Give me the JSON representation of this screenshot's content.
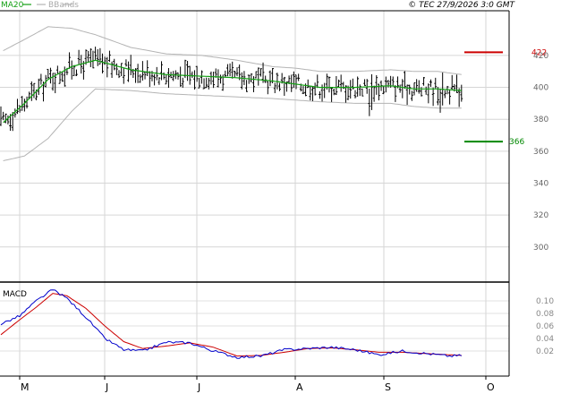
{
  "header": {
    "legend_ma_label": "MA20",
    "legend_bb_label": "BBands",
    "copyright": "© TEC 27/9/2026 3:0 GMT"
  },
  "colors": {
    "ohlc": "#000000",
    "ma20": "#14a014",
    "bbands": "#b4b4b4",
    "macd": "#0000cc",
    "signal": "#cc0000",
    "resistance": "#cc0000",
    "support": "#008800",
    "grid": "#d6d6d6",
    "axis": "#000000"
  },
  "chart_data": [
    {
      "type": "ohlc",
      "ylim": [
        278,
        448
      ],
      "yticks": [
        300,
        320,
        340,
        360,
        380,
        400,
        420
      ],
      "xlabels": [
        "M",
        "J",
        "J",
        "A",
        "S",
        "O"
      ],
      "series": [
        {
          "name": "MA20",
          "x": [
            1,
            10,
            20,
            30,
            40,
            55,
            70,
            85,
            100,
            115,
            125,
            135,
            150,
            165,
            175,
            185,
            195
          ],
          "values": [
            378,
            390,
            405,
            413,
            417,
            411,
            408,
            407,
            406,
            404,
            402,
            400,
            400,
            401,
            399,
            399,
            398
          ]
        },
        {
          "name": "BBands upper",
          "x": [
            1,
            10,
            20,
            30,
            40,
            55,
            70,
            85,
            100,
            115,
            125,
            135,
            150,
            165,
            175,
            185,
            195
          ],
          "values": [
            423,
            430,
            438,
            437,
            433,
            425,
            421,
            420,
            417,
            413,
            412,
            410,
            410,
            411,
            410,
            410,
            408
          ]
        },
        {
          "name": "BBands lower",
          "x": [
            1,
            10,
            20,
            30,
            40,
            55,
            70,
            85,
            100,
            115,
            125,
            135,
            150,
            165,
            175,
            185,
            195
          ],
          "values": [
            354,
            357,
            368,
            385,
            399,
            398,
            396,
            395,
            394,
            393,
            392,
            391,
            390,
            390,
            388,
            387,
            387
          ]
        }
      ],
      "levels": [
        {
          "name": "resistance",
          "value": 422,
          "label": "422"
        },
        {
          "name": "support",
          "value": 366,
          "label": "366"
        }
      ]
    },
    {
      "type": "line",
      "title": "MACD",
      "ylim": [
        -0.02,
        0.13
      ],
      "yticks": [
        0.02,
        0.04,
        0.06,
        0.08,
        0.1
      ],
      "ytick_labels": [
        "0.02",
        "0.04",
        "0.06",
        "0.08",
        "0.10"
      ],
      "series": [
        {
          "name": "MACD",
          "x": [
            0,
            8,
            15,
            22,
            28,
            36,
            44,
            52,
            60,
            70,
            80,
            90,
            100,
            110,
            120,
            130,
            140,
            150,
            160,
            170,
            180,
            190,
            195
          ],
          "values": [
            0.063,
            0.076,
            0.1,
            0.118,
            0.104,
            0.074,
            0.04,
            0.022,
            0.02,
            0.034,
            0.033,
            0.02,
            0.01,
            0.012,
            0.022,
            0.024,
            0.026,
            0.022,
            0.014,
            0.02,
            0.016,
            0.012,
            0.013
          ]
        },
        {
          "name": "Signal",
          "x": [
            0,
            8,
            15,
            22,
            28,
            36,
            44,
            52,
            60,
            70,
            80,
            90,
            100,
            110,
            120,
            130,
            140,
            150,
            160,
            170,
            180,
            190,
            195
          ],
          "values": [
            0.046,
            0.07,
            0.09,
            0.112,
            0.108,
            0.088,
            0.06,
            0.035,
            0.024,
            0.028,
            0.033,
            0.026,
            0.012,
            0.013,
            0.018,
            0.024,
            0.025,
            0.022,
            0.018,
            0.018,
            0.016,
            0.014,
            0.013
          ]
        }
      ]
    }
  ]
}
